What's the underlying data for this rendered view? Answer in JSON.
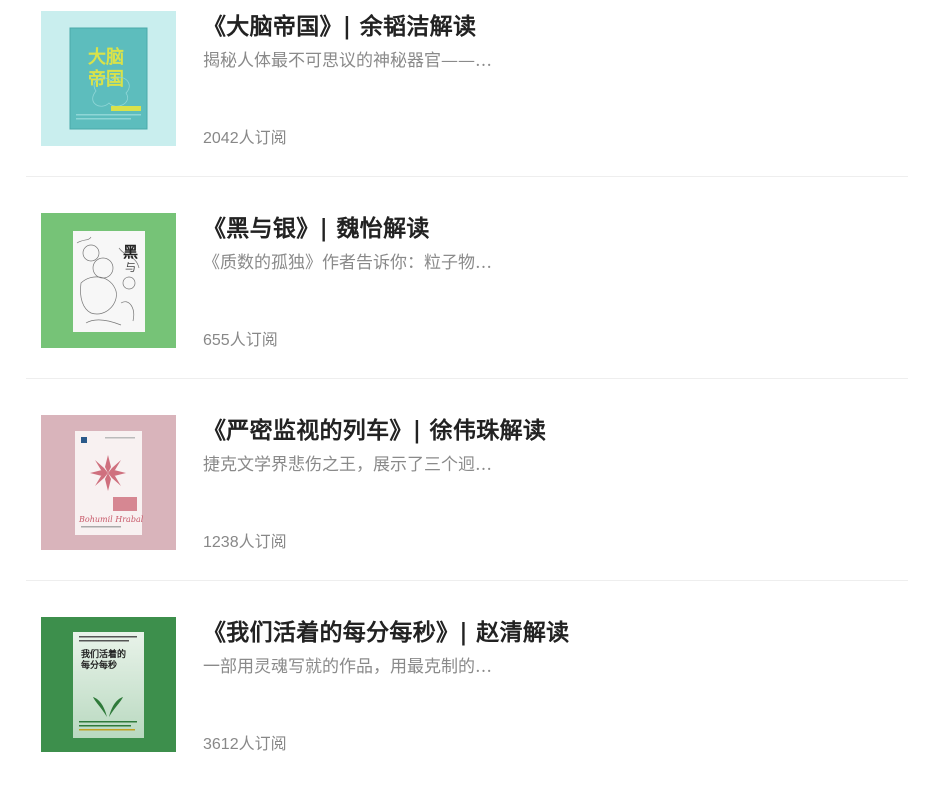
{
  "books": [
    {
      "title": "《大脑帝国》| 余韬洁解读",
      "description": "揭秘人体最不可思议的神秘器官——…",
      "subscribers": "2042人订阅",
      "cover": {
        "background": "#c9eeee",
        "book_color": "#5dbdbd",
        "accent": "#d9e24a",
        "text": "大脑帝国",
        "icon": "brain-book-cover"
      }
    },
    {
      "title": "《黑与银》| 魏怡解读",
      "description": "《质数的孤独》作者告诉你：粒子物…",
      "subscribers": "655人订阅",
      "cover": {
        "background": "#76c377",
        "book_color": "#f5f5f5",
        "accent": "#222222",
        "text": "黑与",
        "icon": "black-and-silver-book-cover"
      }
    },
    {
      "title": "《严密监视的列车》| 徐伟珠解读",
      "description": "捷克文学界悲伤之王，展示了三个迥…",
      "subscribers": "1238人订阅",
      "cover": {
        "background": "#d9b4bb",
        "book_color": "#f7eeee",
        "accent": "#c85a6a",
        "text": "Bohumil Hrabal",
        "icon": "train-book-cover"
      }
    },
    {
      "title": "《我们活着的每分每秒》| 赵清解读",
      "description": "一部用灵魂写就的作品，用最克制的…",
      "subscribers": "3612人订阅",
      "cover": {
        "background": "#3d8f4c",
        "book_color": "#c9e3cf",
        "accent": "#2f7a3a",
        "text": "我们活着的每分每秒",
        "icon": "every-second-book-cover"
      }
    }
  ]
}
